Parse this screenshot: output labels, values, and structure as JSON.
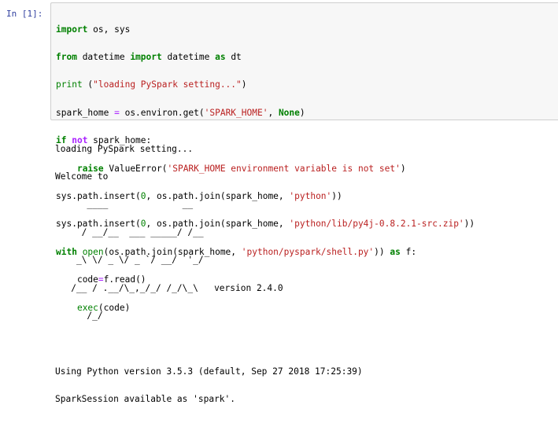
{
  "cell": {
    "prompt": "In [1]:",
    "code_lines": [
      {
        "kw1": "import",
        "rest": " os, sys"
      },
      {
        "kw1": "from",
        "mid": " datetime ",
        "kw2": "import",
        "mid2": " datetime ",
        "kw3": "as",
        "rest": " dt"
      },
      {
        "fn": "print",
        "rest": " (",
        "str": "\"loading PySpark setting...\"",
        "end": ")"
      },
      {
        "pre": "spark_home ",
        "op": "=",
        "mid": " os.environ.get(",
        "str": "'SPARK_HOME'",
        "mid2": ", ",
        "kw": "None",
        "end": ")"
      },
      {
        "kw1": "if",
        "op": " not",
        "rest": " spark_home:"
      },
      {
        "indent": "    ",
        "kw": "raise",
        "exc": " ValueError",
        "mid": "(",
        "str": "'SPARK_HOME environment variable is not set'",
        "end": ")"
      },
      {
        "pre": "sys.path.insert(",
        "num": "0",
        "mid": ", os.path.join(spark_home, ",
        "str": "'python'",
        "end": "))"
      },
      {
        "pre": "sys.path.insert(",
        "num": "0",
        "mid": ", os.path.join(spark_home, ",
        "str": "'python/lib/py4j-0.8.2.1-src.zip'",
        "end": "))"
      },
      {
        "kw1": "with",
        "fn": " open",
        "mid": "(os.path.join(spark_home, ",
        "str": "'python/pyspark/shell.py'",
        "mid2": ")) ",
        "kw2": "as",
        "end": " f:"
      },
      {
        "indent": "    ",
        "pre": "code",
        "op": "=",
        "end": "f.read()"
      },
      {
        "indent": "    ",
        "fn": "exec",
        "end": "(code)"
      }
    ]
  },
  "output": {
    "lines": [
      "loading PySpark setting...",
      "Welcome to",
      "      ____              __",
      "     / __/__  ___ _____/ /__",
      "    _\\ \\/ _ \\/ _ `/ __/  '_/",
      "   /__ / .__/\\_,_/_/ /_/\\_\\   version 2.4.0",
      "      /_/",
      "",
      "Using Python version 3.5.3 (default, Sep 27 2018 17:25:39)",
      "SparkSession available as 'spark'."
    ]
  },
  "colors": {
    "keyword": "#008000",
    "string": "#ba2121",
    "operator": "#aa22ff",
    "exception": "#d2413a",
    "prompt": "#303f9f",
    "input_bg": "#f7f7f7",
    "input_border": "#cfcfcf"
  }
}
